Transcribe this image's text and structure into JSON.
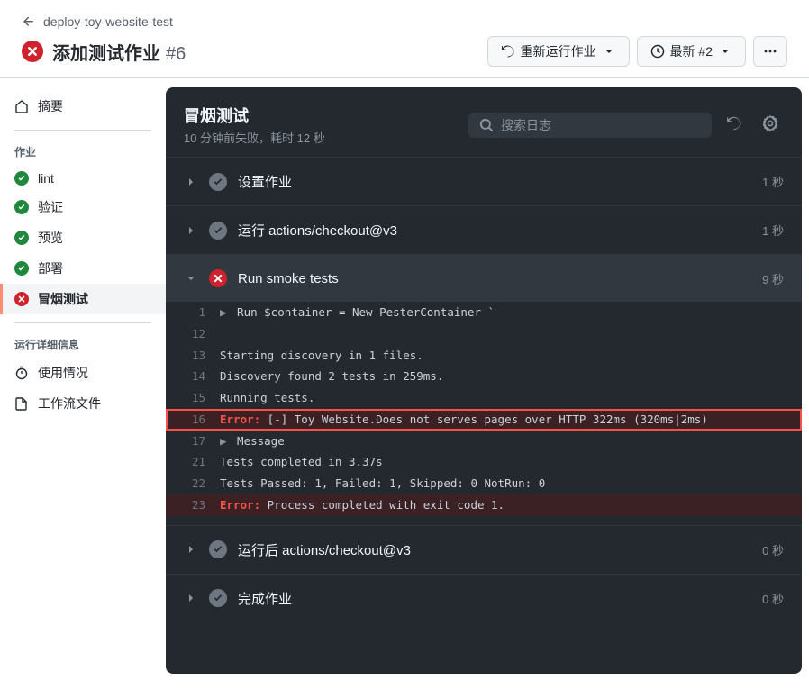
{
  "breadcrumb": "deploy-toy-website-test",
  "title": "添加测试作业",
  "run_number": "#6",
  "actions": {
    "rerun": "重新运行作业",
    "latest": "最新 #2"
  },
  "sidebar": {
    "summary": "摘要",
    "jobs_heading": "作业",
    "jobs": [
      {
        "name": "lint",
        "status": "success",
        "active": false
      },
      {
        "name": "验证",
        "status": "success",
        "active": false
      },
      {
        "name": "预览",
        "status": "success",
        "active": false
      },
      {
        "name": "部署",
        "status": "success",
        "active": false
      },
      {
        "name": "冒烟测试",
        "status": "error",
        "active": true
      }
    ],
    "details_heading": "运行详细信息",
    "details": [
      {
        "name": "使用情况"
      },
      {
        "name": "工作流文件"
      }
    ]
  },
  "main": {
    "title": "冒烟测试",
    "subtitle": "10 分钟前失败，耗时 12 秒",
    "search_placeholder": "搜索日志"
  },
  "steps": [
    {
      "name": "设置作业",
      "status": "success",
      "time": "1 秒",
      "expanded": false
    },
    {
      "name": "运行 actions/checkout@v3",
      "status": "success",
      "time": "1 秒",
      "expanded": false
    },
    {
      "name": "Run smoke tests",
      "status": "error",
      "time": "9 秒",
      "expanded": true
    },
    {
      "name": "运行后 actions/checkout@v3",
      "status": "success",
      "time": "0 秒",
      "expanded": false
    },
    {
      "name": "完成作业",
      "status": "success",
      "time": "0 秒",
      "expanded": false
    }
  ],
  "logs": [
    {
      "n": "1",
      "text": "Run $container = New-PesterContainer `",
      "caret": true
    },
    {
      "n": "12",
      "text": ""
    },
    {
      "n": "13",
      "text": "Starting discovery in 1 files."
    },
    {
      "n": "14",
      "text": "Discovery found 2 tests in 259ms."
    },
    {
      "n": "15",
      "text": "Running tests."
    },
    {
      "n": "16",
      "text": "[-] Toy Website.Does not serves pages over HTTP 322ms (320ms|2ms)",
      "error": true,
      "highlight": true
    },
    {
      "n": "17",
      "text": "Message",
      "caret": true
    },
    {
      "n": "21",
      "text": "Tests completed in 3.37s"
    },
    {
      "n": "22",
      "text": "Tests Passed: 1, Failed: 1, Skipped: 0 NotRun: 0"
    },
    {
      "n": "23",
      "text": "Process completed with exit code 1.",
      "error": true
    }
  ]
}
